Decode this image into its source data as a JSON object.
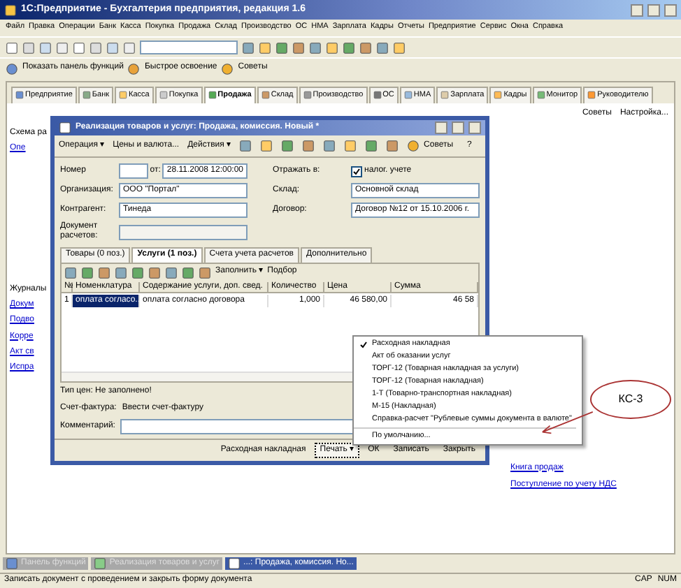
{
  "app_title": "1С:Предприятие - Бухгалтерия предприятия, редакция 1.6",
  "menu": [
    "Файл",
    "Правка",
    "Операции",
    "Банк",
    "Касса",
    "Покупка",
    "Продажа",
    "Склад",
    "Производство",
    "ОС",
    "НМА",
    "Зарплата",
    "Кадры",
    "Отчеты",
    "Предприятие",
    "Сервис",
    "Окна",
    "Справка"
  ],
  "quick_bar": [
    "Показать панель функций",
    "Быстрое освоение",
    "Советы"
  ],
  "sections": [
    {
      "label": "Предприятие",
      "selected": false
    },
    {
      "label": "Банк",
      "selected": false
    },
    {
      "label": "Касса",
      "selected": false
    },
    {
      "label": "Покупка",
      "selected": false
    },
    {
      "label": "Продажа",
      "selected": true
    },
    {
      "label": "Склад",
      "selected": false
    },
    {
      "label": "Производство",
      "selected": false
    },
    {
      "label": "ОС",
      "selected": false
    },
    {
      "label": "НМА",
      "selected": false
    },
    {
      "label": "Зарплата",
      "selected": false
    },
    {
      "label": "Кадры",
      "selected": false
    },
    {
      "label": "Монитор",
      "selected": false
    },
    {
      "label": "Руководителю",
      "selected": false
    }
  ],
  "panel": {
    "tips": "Советы",
    "settings": "Настройка...",
    "scheme": "Схема ра",
    "scheme_link": "Опе",
    "journals": "Журналы",
    "journal_links": [
      "Докум",
      "Подво",
      "Корре",
      "Акт св",
      "Испра"
    ],
    "right_links": [
      "Книга продаж",
      "Поступление по учету НДС"
    ]
  },
  "doc": {
    "title": "Реализация товаров и услуг: Продажа, комиссия. Новый *",
    "toolbar": [
      "Операция ▾",
      "Цены и валюта...",
      "Действия ▾"
    ],
    "tips": "Советы",
    "help": "?",
    "number_label": "Номер",
    "date_label": "от:",
    "date": "28.11.2008 12:00:00",
    "reflect_label": "Отражать в:",
    "tax_accounting": {
      "label": "налог. учете",
      "checked": true
    },
    "org_label": "Организация:",
    "org": "ООО \"Портал\"",
    "warehouse_label": "Склад:",
    "warehouse": "Основной склад",
    "contractor_label": "Контрагент:",
    "contractor": "Тинеда",
    "contract_label": "Договор:",
    "contract": "Договор №12 от 15.10.2006 г.",
    "settlement_label": "Документ расчетов:",
    "tabs": [
      {
        "label": "Товары (0 поз.)",
        "selected": false
      },
      {
        "label": "Услуги (1 поз.)",
        "selected": true
      },
      {
        "label": "Счета учета расчетов",
        "selected": false
      },
      {
        "label": "Дополнительно",
        "selected": false
      }
    ],
    "fill": "Заполнить ▾",
    "pick": "Подбор",
    "table": {
      "columns": [
        "№",
        "Номенклатура",
        "Содержание услуги, доп. свед.",
        "Количество",
        "Цена",
        "Сумма"
      ],
      "rows": [
        {
          "cells": [
            "1",
            "оплата согласо...",
            "оплата согласно договора",
            "1,000",
            "46 580,00",
            "46 58"
          ],
          "selected": true
        }
      ]
    },
    "price_type": "Тип цен: Не заполнено!",
    "invoice_label": "Счет-фактура:",
    "invoice_link": "Ввести счет-фактуру",
    "comment_label": "Комментарий:",
    "buttons": [
      "Расходная накладная",
      "Печать ▾",
      "ОК",
      "Записать",
      "Закрыть"
    ]
  },
  "print_menu": [
    {
      "label": "Расходная накладная",
      "checked": true
    },
    {
      "label": "Акт об оказании услуг",
      "checked": false
    },
    {
      "label": "ТОРГ-12 (Товарная накладная за услуги)",
      "checked": false
    },
    {
      "label": "ТОРГ-12 (Товарная накладная)",
      "checked": false
    },
    {
      "label": "1-Т (Товарно-транспортная накладная)",
      "checked": false
    },
    {
      "label": "М-15 (Накладная)",
      "checked": false
    },
    {
      "label": "Справка-расчет \"Рублевые суммы документа в валюте\"",
      "checked": false
    },
    {
      "label": "По умолчанию...",
      "checked": false
    }
  ],
  "callout": "КС-3",
  "taskbar": [
    {
      "label": "Панель функций",
      "selected": false
    },
    {
      "label": "Реализация товаров и услуг",
      "selected": false
    },
    {
      "label": "...: Продажа, комиссия. Но...",
      "selected": true
    }
  ],
  "status_bar": {
    "text": "Записать документ с проведением и закрыть форму документа",
    "caps": "CAP",
    "num": "NUM"
  }
}
